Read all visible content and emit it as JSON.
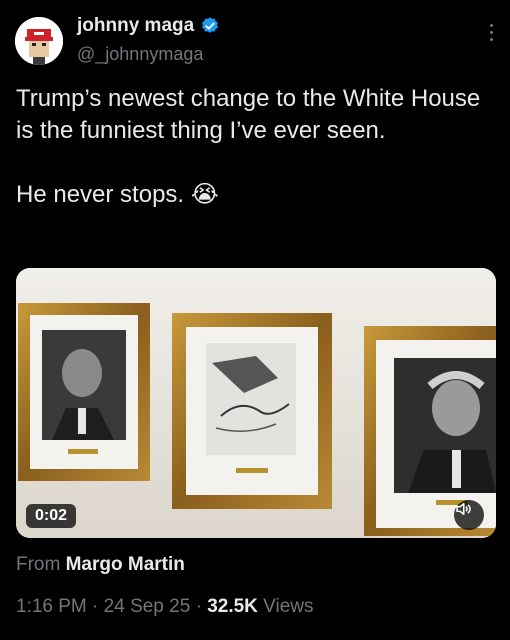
{
  "author": {
    "name": "johnny maga",
    "handle": "@_johnnymaga",
    "verified": true
  },
  "tweet": {
    "line1": "Trump’s newest change to the White House is the funniest thing I’ve ever seen.",
    "line2": "He never stops. 😭"
  },
  "media": {
    "duration": "0:02",
    "sound_icon": "speaker-icon"
  },
  "source": {
    "prefix": "From",
    "name": "Margo Martin"
  },
  "meta": {
    "time": "1:16 PM",
    "sep1": " · ",
    "date": "24 Sep 25",
    "sep2": " · ",
    "views_count": "32.5K",
    "views_label": " Views"
  },
  "colors": {
    "background": "#000000",
    "text": "#e7e9ea",
    "secondary": "#71767b",
    "verified": "#1d9bf0"
  }
}
